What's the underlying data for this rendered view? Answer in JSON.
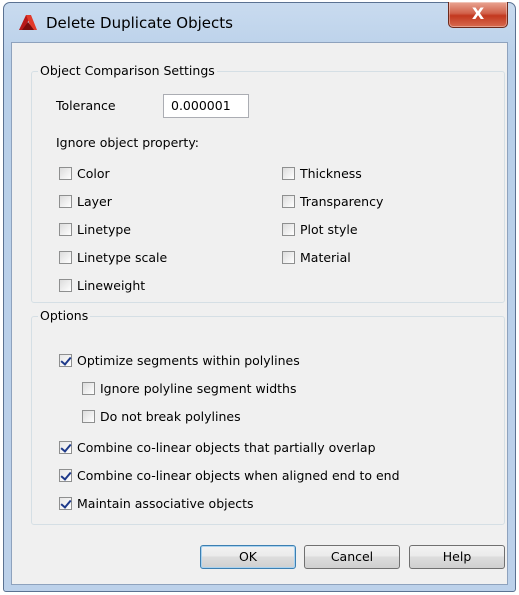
{
  "window": {
    "title": "Delete Duplicate Objects",
    "close_glyph": "X",
    "app_icon": "autocad-icon"
  },
  "comparison": {
    "group_label": "Object Comparison Settings",
    "tolerance_label": "Tolerance",
    "tolerance_value": "0.000001",
    "ignore_label": "Ignore object property:",
    "properties_left": [
      {
        "label": "Color",
        "checked": false
      },
      {
        "label": "Layer",
        "checked": false
      },
      {
        "label": "Linetype",
        "checked": false
      },
      {
        "label": "Linetype scale",
        "checked": false
      },
      {
        "label": "Lineweight",
        "checked": false
      }
    ],
    "properties_right": [
      {
        "label": "Thickness",
        "checked": false
      },
      {
        "label": "Transparency",
        "checked": false
      },
      {
        "label": "Plot style",
        "checked": false
      },
      {
        "label": "Material",
        "checked": false
      }
    ]
  },
  "options": {
    "group_label": "Options",
    "items": [
      {
        "label": "Optimize segments within polylines",
        "checked": true
      },
      {
        "label": "Ignore polyline segment widths",
        "checked": false
      },
      {
        "label": "Do not break polylines",
        "checked": false
      },
      {
        "label": "Combine co-linear objects that partially overlap",
        "checked": true
      },
      {
        "label": "Combine co-linear objects when aligned end to end",
        "checked": true
      },
      {
        "label": "Maintain associative objects",
        "checked": true
      }
    ]
  },
  "buttons": {
    "ok": "OK",
    "cancel": "Cancel",
    "help": "Help"
  }
}
